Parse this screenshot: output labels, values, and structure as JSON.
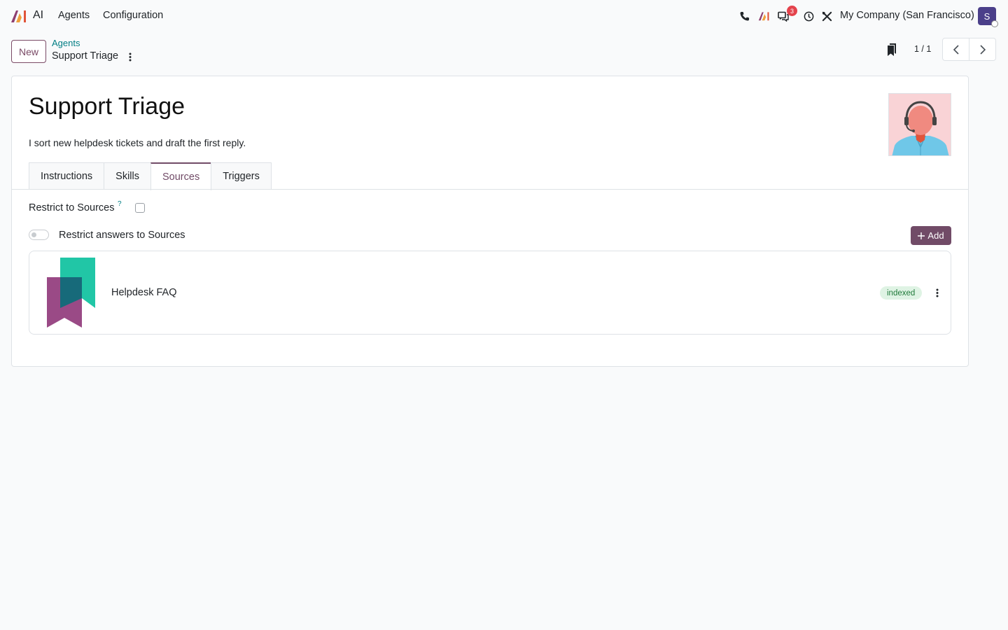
{
  "navbar": {
    "app_name": "AI",
    "menu": [
      "Agents",
      "Configuration"
    ],
    "messages_count": "3",
    "company": "My Company (San Francisco)",
    "user_initial": "S",
    "icons": [
      "phone-icon",
      "ai-icon",
      "messages-icon",
      "clock-icon",
      "tools-icon"
    ]
  },
  "control_panel": {
    "new_label": "New",
    "breadcrumb_parent": "Agents",
    "breadcrumb_current": "Support Triage",
    "pager_value": "1 / 1"
  },
  "form": {
    "title": "Support Triage",
    "subtitle": "I sort new helpdesk tickets and draft the first reply.",
    "tabs": [
      "Instructions",
      "Skills",
      "Sources",
      "Triggers"
    ],
    "active_tab": "Sources",
    "restrict_label": "Restrict to Sources",
    "help_mark": "?",
    "restrict_checked": false,
    "toggle_label": "Restrict answers to Sources",
    "toggle_on": false,
    "add_label": "Add",
    "sources": [
      {
        "name": "Helpdesk FAQ",
        "status": "indexed"
      }
    ]
  },
  "colors": {
    "brand": "#714b67",
    "link": "#017e84",
    "badge_red": "#e4434c",
    "indexed_bg": "#dff3e4",
    "indexed_text": "#1f7a3a"
  }
}
